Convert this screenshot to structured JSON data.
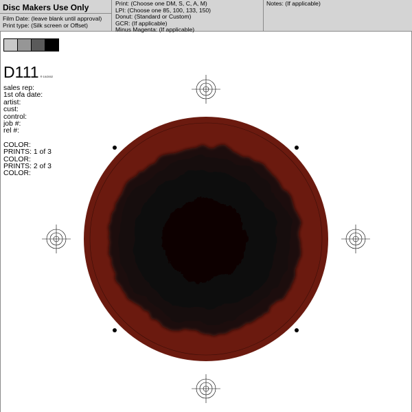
{
  "header": {
    "title": "Disc Makers Use Only",
    "col1_lines": [
      "Film Date: (leave blank until approval)",
      "Print type: (Silk screen or Offset)"
    ],
    "col2_lines": [
      "Print: (Choose one DM, S, C, A, M)",
      "LPI: (Choose one 85, 100, 133, 150)",
      "Donut: (Standard or Custom)",
      "GCR: (If applicable)",
      "Minus Magenta: (If applicable)"
    ],
    "col3_lines": [
      "Notes: (If applicable)"
    ]
  },
  "swatches": [
    "#c8c8c8",
    "#969696",
    "#5a5a5a",
    "#000000"
  ],
  "slug": {
    "id": "D111",
    "stamp": "® 10/2002",
    "fields": [
      "sales rep:",
      "1st ofa date:",
      "artist:",
      "cust:",
      "control:",
      "job #:",
      "rel #:"
    ],
    "colors": [
      "COLOR:",
      "PRINTS: 1 of 3",
      "COLOR:",
      "PRINTS: 2 of 3",
      "COLOR:"
    ]
  },
  "disc": {
    "outer_color": "#6b1a0f",
    "inner_color": "#0f0808",
    "ring_color": "#3b0e08"
  },
  "icons": [
    "registration-target-icon",
    "corner-dot-icon"
  ]
}
